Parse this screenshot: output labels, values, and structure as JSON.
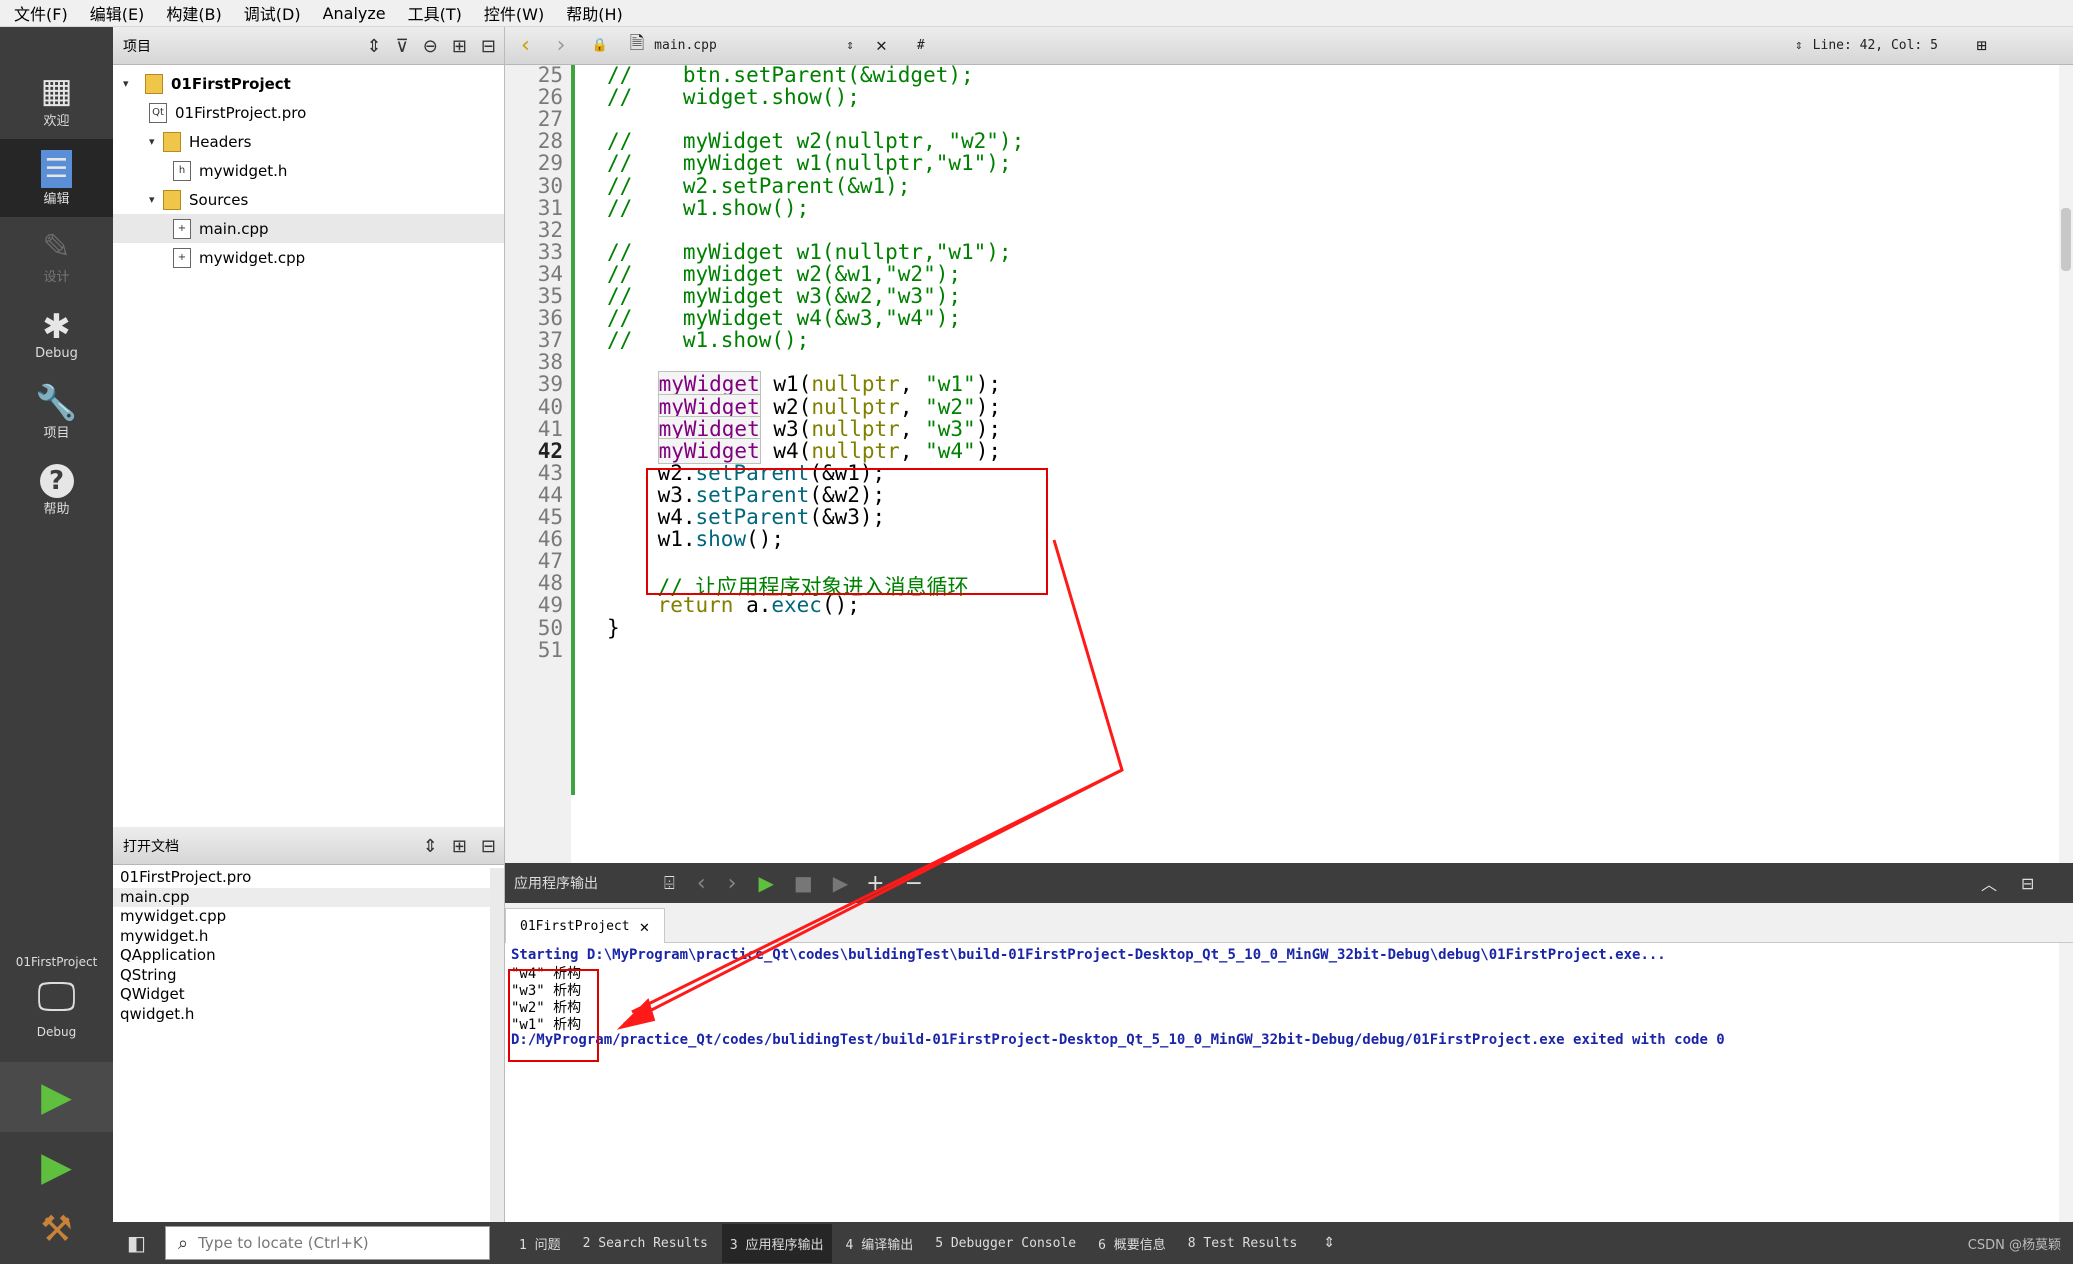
{
  "menu": [
    "文件(F)",
    "编辑(E)",
    "构建(B)",
    "调试(D)",
    "Analyze",
    "工具(T)",
    "控件(W)",
    "帮助(H)"
  ],
  "modes": [
    {
      "label": "欢迎",
      "icon": "grid-icon"
    },
    {
      "label": "编辑",
      "icon": "edit-doc-icon"
    },
    {
      "label": "设计",
      "icon": "pencil-icon"
    },
    {
      "label": "Debug",
      "icon": "bug-icon"
    },
    {
      "label": "项目",
      "icon": "wrench-icon"
    },
    {
      "label": "帮助",
      "icon": "help-icon"
    }
  ],
  "kit": {
    "project": "01FirstProject",
    "config": "Debug"
  },
  "project_pane": {
    "title": "项目",
    "tree": [
      {
        "label": "01FirstProject",
        "bold": true
      },
      {
        "label": "01FirstProject.pro"
      },
      {
        "label": "Headers"
      },
      {
        "label": "mywidget.h"
      },
      {
        "label": "Sources"
      },
      {
        "label": "main.cpp"
      },
      {
        "label": "mywidget.cpp"
      }
    ]
  },
  "open_docs": {
    "title": "打开文档",
    "items": [
      "01FirstProject.pro",
      "main.cpp",
      "mywidget.cpp",
      "mywidget.h",
      "QApplication",
      "QString",
      "QWidget",
      "qwidget.h"
    ]
  },
  "locator": {
    "placeholder": "Type to locate (Ctrl+K)"
  },
  "editor_toolbar": {
    "file": "main.cpp",
    "symbol": "#",
    "position": "Line: 42, Col: 5"
  },
  "editor": {
    "current_line": 42,
    "lines": [
      {
        "n": 25,
        "text": "//    btn.setParent(&widget);"
      },
      {
        "n": 26,
        "text": "//    widget.show();"
      },
      {
        "n": 27,
        "text": ""
      },
      {
        "n": 28,
        "text": "//    myWidget w2(nullptr, \"w2\");"
      },
      {
        "n": 29,
        "text": "//    myWidget w1(nullptr,\"w1\");"
      },
      {
        "n": 30,
        "text": "//    w2.setParent(&w1);"
      },
      {
        "n": 31,
        "text": "//    w1.show();"
      },
      {
        "n": 32,
        "text": ""
      },
      {
        "n": 33,
        "text": "//    myWidget w1(nullptr,\"w1\");"
      },
      {
        "n": 34,
        "text": "//    myWidget w2(&w1,\"w2\");"
      },
      {
        "n": 35,
        "text": "//    myWidget w3(&w2,\"w3\");"
      },
      {
        "n": 36,
        "text": "//    myWidget w4(&w3,\"w4\");"
      },
      {
        "n": 37,
        "text": "//    w1.show();"
      },
      {
        "n": 38,
        "text": ""
      },
      {
        "n": 39,
        "text": "    myWidget w1(nullptr, \"w1\");"
      },
      {
        "n": 40,
        "text": "    myWidget w2(nullptr, \"w2\");"
      },
      {
        "n": 41,
        "text": "    myWidget w3(nullptr, \"w3\");"
      },
      {
        "n": 42,
        "text": "    myWidget w4(nullptr, \"w4\");"
      },
      {
        "n": 43,
        "text": "    w2.setParent(&w1);"
      },
      {
        "n": 44,
        "text": "    w3.setParent(&w2);"
      },
      {
        "n": 45,
        "text": "    w4.setParent(&w3);"
      },
      {
        "n": 46,
        "text": "    w1.show();"
      },
      {
        "n": 47,
        "text": ""
      },
      {
        "n": 48,
        "text": "    // 让应用程序对象进入消息循环"
      },
      {
        "n": 49,
        "text": "    return a.exec();"
      },
      {
        "n": 50,
        "text": "}"
      },
      {
        "n": 51,
        "text": ""
      }
    ]
  },
  "output_pane": {
    "title": "应用程序输出",
    "tab": "01FirstProject",
    "lines": [
      {
        "text": "Starting D:\\MyProgram\\practice_Qt\\codes\\bulidingTest\\build-01FirstProject-Desktop_Qt_5_10_0_MinGW_32bit-Debug\\debug\\01FirstProject.exe...",
        "style": "blue"
      },
      {
        "text": "\"w4\" 析构",
        "style": "normal"
      },
      {
        "text": "\"w3\" 析构",
        "style": "normal"
      },
      {
        "text": "\"w2\" 析构",
        "style": "normal"
      },
      {
        "text": "\"w1\" 析构",
        "style": "normal"
      },
      {
        "text": "D:/MyProgram/practice_Qt/codes/bulidingTest/build-01FirstProject-Desktop_Qt_5_10_0_MinGW_32bit-Debug/debug/01FirstProject.exe exited with code 0",
        "style": "blue"
      }
    ]
  },
  "statusbar": {
    "tabs": [
      {
        "num": "1",
        "label": "问题"
      },
      {
        "num": "2",
        "label": "Search Results"
      },
      {
        "num": "3",
        "label": "应用程序输出"
      },
      {
        "num": "4",
        "label": "编译输出"
      },
      {
        "num": "5",
        "label": "Debugger Console"
      },
      {
        "num": "6",
        "label": "概要信息"
      },
      {
        "num": "8",
        "label": "Test Results"
      }
    ],
    "watermark": "CSDN @杨莫颖"
  },
  "colors": {
    "dark": "#3d3d3d",
    "highlight_box": "#e00000",
    "comment": "#008000",
    "type": "#800080",
    "output_blue": "#1a25a8"
  }
}
